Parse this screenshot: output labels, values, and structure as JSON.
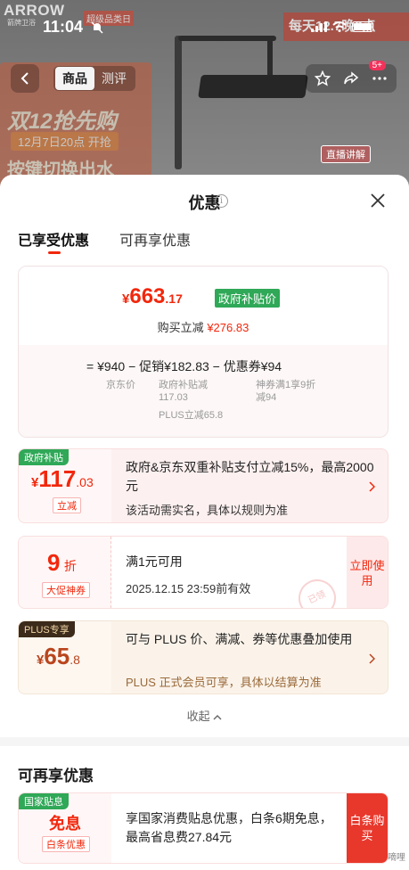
{
  "status": {
    "time": "11:04"
  },
  "background": {
    "brand": "ARROW",
    "brand_sub": "箭牌卫浴",
    "brand_tag": "超级品类日",
    "top_promo": "每天12.7晚8点",
    "promo_line1": "双12抢先购",
    "promo_line2": "12月7日20点 开抢",
    "promo_line3": "按键切换出水",
    "live_tag": "直播讲解"
  },
  "nav": {
    "tabs": [
      {
        "label": "商品"
      },
      {
        "label": "测评"
      }
    ],
    "badge": "5+"
  },
  "sheet": {
    "title": "优惠",
    "info_icon": "i",
    "tabs": [
      {
        "label": "已享受优惠"
      },
      {
        "label": "可再享优惠"
      }
    ]
  },
  "summary": {
    "price_symbol": "¥",
    "price_int": "663",
    "price_dec": ".17",
    "price_tag": "政府补贴价",
    "instant_cut_label": "购买立减",
    "instant_cut_value": "¥276.83",
    "calc_line": "=  ¥940  −  促销¥182.83  −  优惠券¥94",
    "jd_price_label": "京东价",
    "promo_detail_1": "政府补贴减",
    "promo_detail_2": "117.03",
    "promo_detail_3": "PLUS立减65.8",
    "coupon_detail_1": "神券满1享9折",
    "coupon_detail_2": "减94"
  },
  "cards": {
    "gov": {
      "corner": "政府补贴",
      "sym": "¥",
      "int": "117",
      "dec": ".03",
      "tag": "立减",
      "text": "政府&京东双重补贴支付立减15%，最高2000元",
      "note": "该活动需实名，具体以规则为准"
    },
    "discount": {
      "value": "9",
      "unit": "折",
      "tag": "大促神券",
      "text": "满1元可用",
      "note": "2025.12.15 23:59前有效",
      "button": "立即使用",
      "stamp": "已领"
    },
    "plus": {
      "corner": "PLUS专享",
      "sym": "¥",
      "int": "65",
      "dec": ".8",
      "text": "可与 PLUS 价、满减、券等优惠叠加使用",
      "note": "PLUS 正式会员可享，具体以结算为准"
    }
  },
  "collapse_label": "收起",
  "more_section": {
    "title": "可再享优惠",
    "card": {
      "corner": "国家贴息",
      "value": "免息",
      "tag": "白条优惠",
      "text": "享国家消费贴息优惠，白条6期免息，最高省息费27.84元",
      "button": "白条购买"
    }
  },
  "watermark": "嘀哩"
}
